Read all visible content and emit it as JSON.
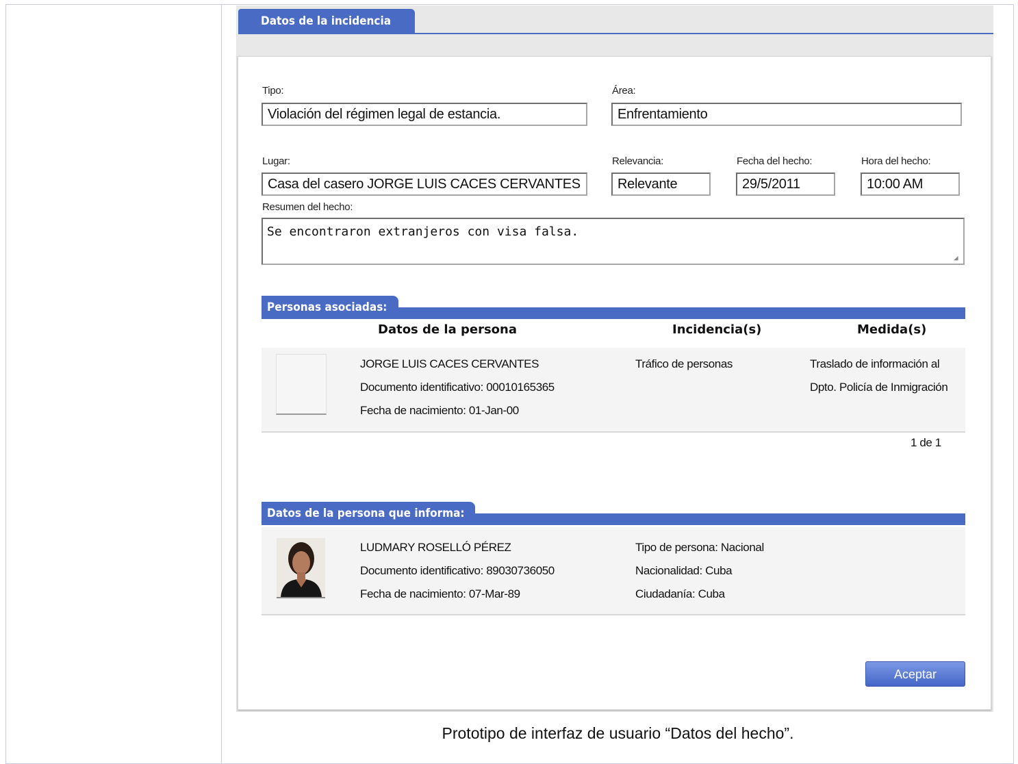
{
  "tab": {
    "title": "Datos de la incidencia"
  },
  "form": {
    "tipo_label": "Tipo:",
    "tipo_value": "Violación del régimen legal de estancia.",
    "area_label": "Área:",
    "area_value": "Enfrentamiento",
    "lugar_label": "Lugar:",
    "lugar_value": "Casa del casero JORGE LUIS CACES CERVANTES",
    "relevancia_label": "Relevancia:",
    "relevancia_value": "Relevante",
    "fecha_label": "Fecha del hecho:",
    "fecha_value": "29/5/2011",
    "hora_label": "Hora del hecho:",
    "hora_value": "10:00 AM",
    "resumen_label": "Resumen del hecho:",
    "resumen_value": "Se encontraron extranjeros con visa falsa."
  },
  "personas": {
    "header": "Personas asociadas:",
    "columns": [
      "Datos de la persona",
      "Incidencia(s)",
      "Medida(s)"
    ],
    "rows": [
      {
        "name": "JORGE LUIS CACES CERVANTES",
        "document": "Documento identificativo: 00010165365",
        "birth": "Fecha de nacimiento: 01-Jan-00",
        "incidencia": "Tráfico de personas",
        "medida_line1": "Traslado de información al",
        "medida_line2": "Dpto. Policía de Inmigración"
      }
    ],
    "pager": "1 de 1"
  },
  "informante": {
    "header": "Datos de la persona que informa:",
    "name": "LUDMARY ROSELLÓ PÉREZ",
    "document": "Documento identificativo: 89030736050",
    "birth": "Fecha de nacimiento: 07-Mar-89",
    "tipo": "Tipo de persona: Nacional",
    "nacionalidad": "Nacionalidad: Cuba",
    "ciudadania": "Ciudadanía: Cuba"
  },
  "actions": {
    "accept": "Aceptar"
  },
  "caption": "Prototipo de interfaz de usuario “Datos del hecho”.",
  "colors": {
    "accent": "#4a6bc4",
    "frame": "#c9c9e8"
  }
}
